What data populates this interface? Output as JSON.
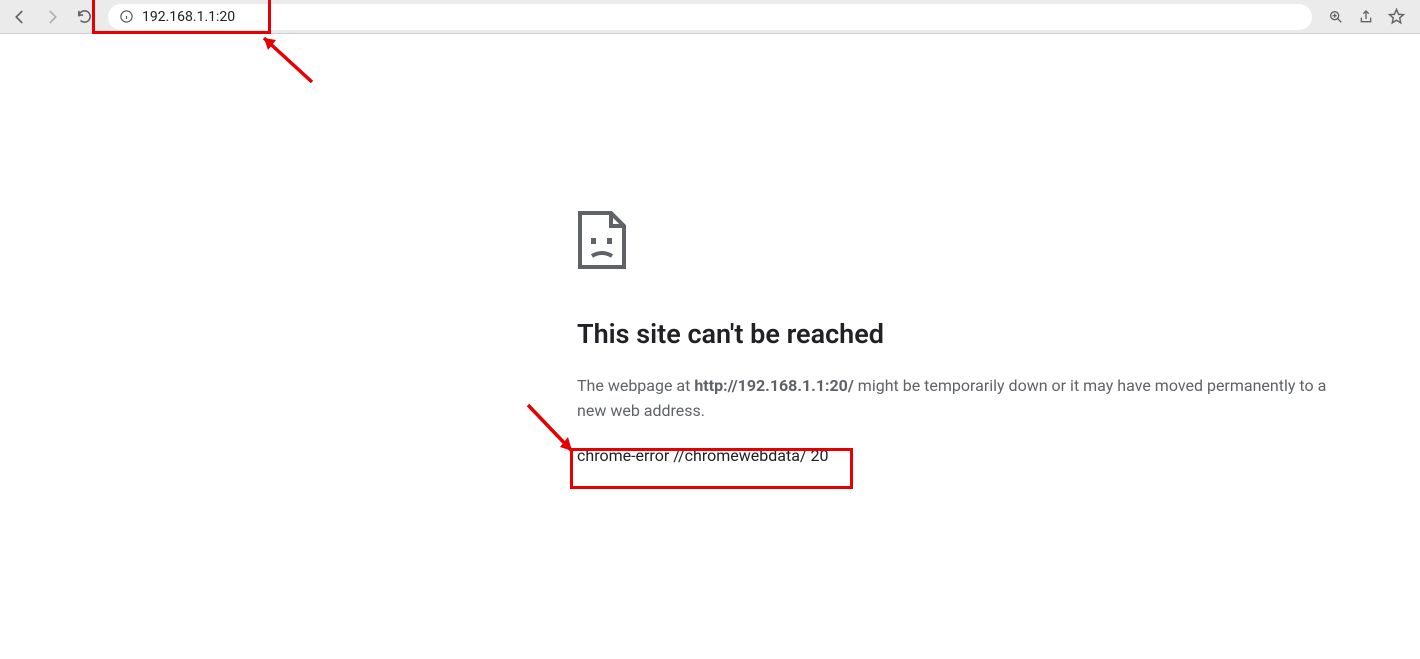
{
  "toolbar": {
    "url": "192.168.1.1:20"
  },
  "error": {
    "title": "This site can't be reached",
    "desc_prefix": "The webpage at ",
    "desc_url": "http://192.168.1.1:20/",
    "desc_suffix": " might be temporarily down or it may have moved permanently to a new web address.",
    "code": "chrome-error //chromewebdata/ 20"
  },
  "annotations": {
    "box1_color": "#e80000",
    "box2_color": "#e80000"
  }
}
